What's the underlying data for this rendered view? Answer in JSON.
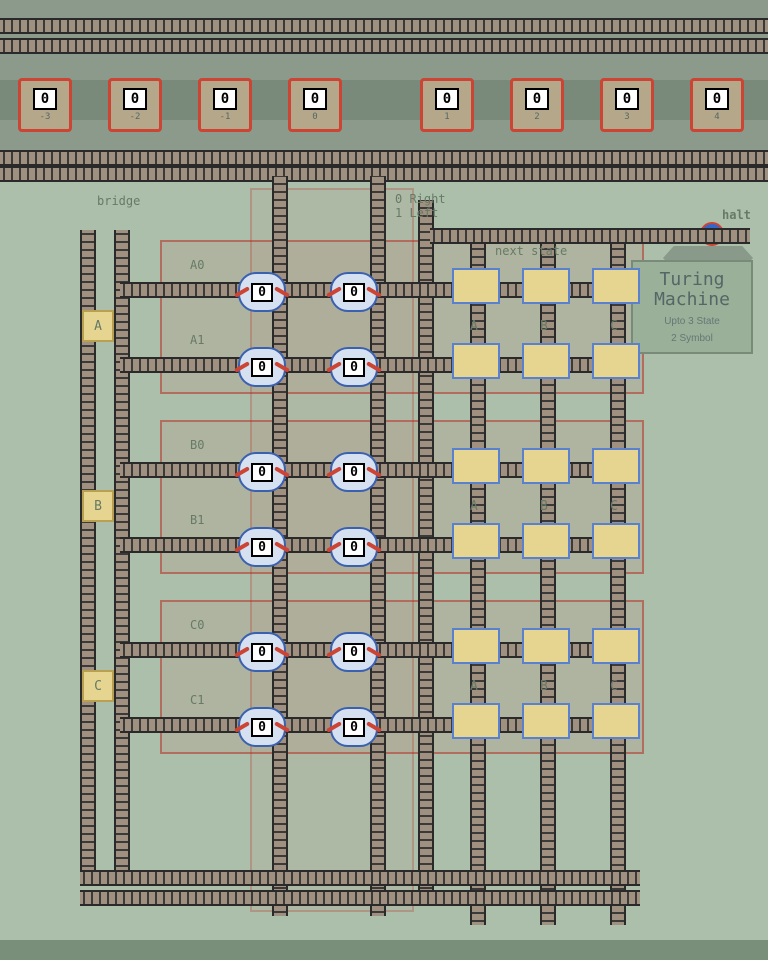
{
  "title": {
    "line1": "Turing",
    "line2": "Machine",
    "sub1": "Upto 3 State",
    "sub2": "2 Symbol"
  },
  "labels": {
    "bridge": "bridge",
    "dir": "0 Right\n1 Left",
    "next_state": "next state",
    "halt": "halt"
  },
  "tape": {
    "cells": [
      {
        "symbol": "0",
        "index": "-3"
      },
      {
        "symbol": "0",
        "index": "-2"
      },
      {
        "symbol": "0",
        "index": "-1"
      },
      {
        "symbol": "0",
        "index": "0"
      },
      {
        "symbol": "0",
        "index": "1"
      },
      {
        "symbol": "0",
        "index": "2"
      },
      {
        "symbol": "0",
        "index": "3"
      },
      {
        "symbol": "0",
        "index": "4"
      }
    ]
  },
  "state_labels": [
    "A",
    "B",
    "C"
  ],
  "rows": [
    "A0",
    "A1",
    "B0",
    "B1",
    "C0",
    "C1"
  ],
  "switch_symbol": "0",
  "next_headers": [
    "A",
    "B",
    "C"
  ]
}
